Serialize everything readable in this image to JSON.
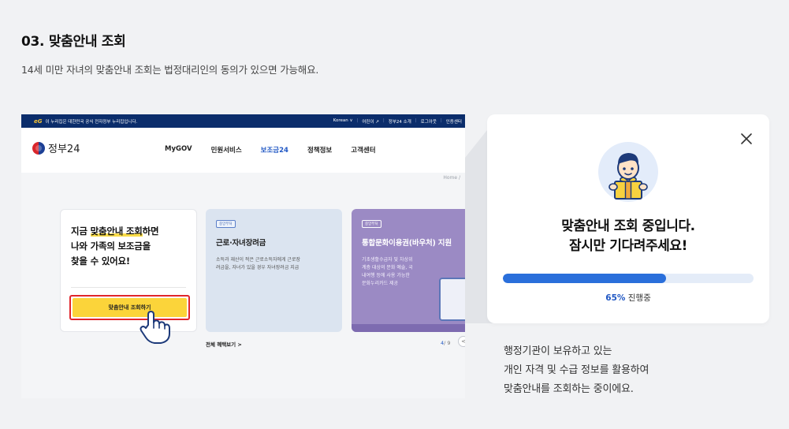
{
  "step": {
    "title": "03. 맞춤안내 조회",
    "description": "14세 미만 자녀의 맞춤안내 조회는 법정대리인의 동의가 있으면 가능해요."
  },
  "portal": {
    "gov_strip": {
      "logo_text": "eG",
      "notice": "이 누리집은 대한민국 공식 전자정부 누리집입니다.",
      "links": [
        "Korean ∨",
        "|",
        "어린이 ↗",
        "|",
        "정부24 소개",
        "|",
        "로그아웃",
        "|",
        "인증센터"
      ]
    },
    "logo_text": "정부24",
    "menu": [
      "MyGOV",
      "민원서비스",
      "보조금24",
      "정책정보",
      "고객센터"
    ],
    "menu_active": "보조금24",
    "breadcrumb": "Home /",
    "intro_card": {
      "line1_pre": "지금 ",
      "line1_highlight": "맞춤안내 조회",
      "line1_post": "하면",
      "line2": "나와 가족의 보조금을",
      "line3": "찾을 수 있어요!",
      "button_label": "맞춤안내 조회하기"
    },
    "benefit_cards": [
      {
        "tag": "중앙부처",
        "title": "근로·자녀장려금",
        "text": "소득과 재산이 적은 근로소득자에게 근로장\n려금을, 자녀가 있을 경우 자녀장려금 지급"
      },
      {
        "tag": "중앙부처",
        "title": "통합문화이용권(바우처) 지원",
        "text": "기초생활수급자 및 차상위\n계층 대상의 문화 예술, 국\n내여행 등에 사용 가능한\n문화누리카드 제공"
      }
    ],
    "more_link": "전체 혜택보기  >",
    "pager": {
      "current": "4",
      "total": "/ 9"
    },
    "pager_prev": "<"
  },
  "modal": {
    "title_line1": "맞춤안내 조회 중입니다.",
    "title_line2": "잠시만 기다려주세요!",
    "progress_percent": 65,
    "progress_label": "65%",
    "progress_suffix": " 진행중",
    "close_icon": "close-icon",
    "illustration": "person-with-gift-icon"
  },
  "caption": "행정기관이 보유하고 있는\n개인 자격 및 수급 정보를 활용하여\n맞춤안내를 조회하는 중이에요.",
  "colors": {
    "gov_blue": "#0b2d6b",
    "accent_blue": "#2a6fdb",
    "cta_yellow": "#fbd43a",
    "cta_border": "#e0262c",
    "purple_card": "#9b8ac4"
  }
}
